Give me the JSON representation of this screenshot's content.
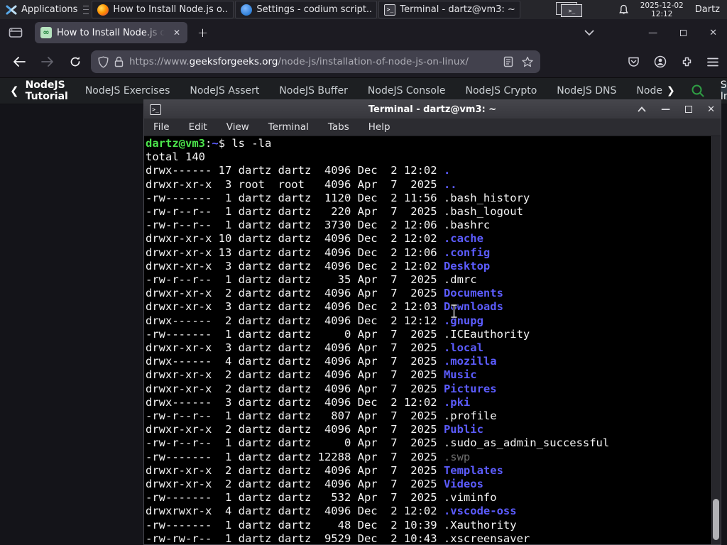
{
  "panel": {
    "applications_label": "Applications",
    "tasks": [
      {
        "icon": "firefox",
        "label": "How to Install Node.js o..."
      },
      {
        "icon": "vscodium",
        "label": "Settings - codium script..."
      },
      {
        "icon": "terminal",
        "label": "Terminal - dartz@vm3: ~"
      }
    ],
    "clock_date": "2025-12-02",
    "clock_time": "12:12",
    "user": "Dartz"
  },
  "browser": {
    "tab_title": "How to Install Node.js on",
    "new_tab_label": "+",
    "url_scheme": "https://www.",
    "url_domain": "geeksforgeeks.org",
    "url_path": "/node-js/installation-of-node-js-on-linux/"
  },
  "page_nav": {
    "back_item": "NodeJS Tutorial",
    "items": [
      "NodeJS Exercises",
      "NodeJS Assert",
      "NodeJS Buffer",
      "NodeJS Console",
      "NodeJS Crypto",
      "NodeJS DNS",
      "Node"
    ],
    "sign_in": "Sign In"
  },
  "terminal": {
    "title": "Terminal - dartz@vm3: ~",
    "menu": [
      "File",
      "Edit",
      "View",
      "Terminal",
      "Tabs",
      "Help"
    ],
    "lines": [
      [
        {
          "t": "dartz@vm3",
          "c": "green"
        },
        {
          "t": ":",
          "c": "fg"
        },
        {
          "t": "~",
          "c": "blue"
        },
        {
          "t": "$ ls -la",
          "c": "fg"
        }
      ],
      [
        {
          "t": "total 140",
          "c": "fg"
        }
      ],
      [
        {
          "t": "drwx------ 17 dartz dartz  4096 Dec  2 12:02 ",
          "c": "fg"
        },
        {
          "t": ".",
          "c": "blue"
        }
      ],
      [
        {
          "t": "drwxr-xr-x  3 root  root   4096 Apr  7  2025 ",
          "c": "fg"
        },
        {
          "t": "..",
          "c": "blue"
        }
      ],
      [
        {
          "t": "-rw-------  1 dartz dartz  1120 Dec  2 11:56 .bash_history",
          "c": "fg"
        }
      ],
      [
        {
          "t": "-rw-r--r--  1 dartz dartz   220 Apr  7  2025 .bash_logout",
          "c": "fg"
        }
      ],
      [
        {
          "t": "-rw-r--r--  1 dartz dartz  3730 Dec  2 12:06 .bashrc",
          "c": "fg"
        }
      ],
      [
        {
          "t": "drwxr-xr-x 10 dartz dartz  4096 Dec  2 12:02 ",
          "c": "fg"
        },
        {
          "t": ".cache",
          "c": "blue"
        }
      ],
      [
        {
          "t": "drwxr-xr-x 13 dartz dartz  4096 Dec  2 12:06 ",
          "c": "fg"
        },
        {
          "t": ".config",
          "c": "blue"
        }
      ],
      [
        {
          "t": "drwxr-xr-x  3 dartz dartz  4096 Dec  2 12:02 ",
          "c": "fg"
        },
        {
          "t": "Desktop",
          "c": "blue"
        }
      ],
      [
        {
          "t": "-rw-r--r--  1 dartz dartz    35 Apr  7  2025 .dmrc",
          "c": "fg"
        }
      ],
      [
        {
          "t": "drwxr-xr-x  2 dartz dartz  4096 Apr  7  2025 ",
          "c": "fg"
        },
        {
          "t": "Documents",
          "c": "blue"
        }
      ],
      [
        {
          "t": "drwxr-xr-x  3 dartz dartz  4096 Dec  2 12:03 ",
          "c": "fg"
        },
        {
          "t": "Downloads",
          "c": "blue"
        }
      ],
      [
        {
          "t": "drwx------  2 dartz dartz  4096 Dec  2 12:12 ",
          "c": "fg"
        },
        {
          "t": ".gnupg",
          "c": "blue"
        }
      ],
      [
        {
          "t": "-rw-------  1 dartz dartz     0 Apr  7  2025 .ICEauthority",
          "c": "fg"
        }
      ],
      [
        {
          "t": "drwxr-xr-x  3 dartz dartz  4096 Apr  7  2025 ",
          "c": "fg"
        },
        {
          "t": ".local",
          "c": "blue"
        }
      ],
      [
        {
          "t": "drwx------  4 dartz dartz  4096 Apr  7  2025 ",
          "c": "fg"
        },
        {
          "t": ".mozilla",
          "c": "blue"
        }
      ],
      [
        {
          "t": "drwxr-xr-x  2 dartz dartz  4096 Apr  7  2025 ",
          "c": "fg"
        },
        {
          "t": "Music",
          "c": "blue"
        }
      ],
      [
        {
          "t": "drwxr-xr-x  2 dartz dartz  4096 Apr  7  2025 ",
          "c": "fg"
        },
        {
          "t": "Pictures",
          "c": "blue"
        }
      ],
      [
        {
          "t": "drwx------  3 dartz dartz  4096 Dec  2 12:02 ",
          "c": "fg"
        },
        {
          "t": ".pki",
          "c": "blue"
        }
      ],
      [
        {
          "t": "-rw-r--r--  1 dartz dartz   807 Apr  7  2025 .profile",
          "c": "fg"
        }
      ],
      [
        {
          "t": "drwxr-xr-x  2 dartz dartz  4096 Apr  7  2025 ",
          "c": "fg"
        },
        {
          "t": "Public",
          "c": "blue"
        }
      ],
      [
        {
          "t": "-rw-r--r--  1 dartz dartz     0 Apr  7  2025 .sudo_as_admin_successful",
          "c": "fg"
        }
      ],
      [
        {
          "t": "-rw-------  1 dartz dartz 12288 Apr  7  2025 ",
          "c": "fg"
        },
        {
          "t": ".swp",
          "c": "gray"
        }
      ],
      [
        {
          "t": "drwxr-xr-x  2 dartz dartz  4096 Apr  7  2025 ",
          "c": "fg"
        },
        {
          "t": "Templates",
          "c": "blue"
        }
      ],
      [
        {
          "t": "drwxr-xr-x  2 dartz dartz  4096 Apr  7  2025 ",
          "c": "fg"
        },
        {
          "t": "Videos",
          "c": "blue"
        }
      ],
      [
        {
          "t": "-rw-------  1 dartz dartz   532 Apr  7  2025 .viminfo",
          "c": "fg"
        }
      ],
      [
        {
          "t": "drwxrwxr-x  4 dartz dartz  4096 Dec  2 12:02 ",
          "c": "fg"
        },
        {
          "t": ".vscode-oss",
          "c": "blue"
        }
      ],
      [
        {
          "t": "-rw-------  1 dartz dartz    48 Dec  2 10:39 .Xauthority",
          "c": "fg"
        }
      ],
      [
        {
          "t": "-rw-rw-r--  1 dartz dartz  9529 Dec  2 10:43 .xscreensaver",
          "c": "fg"
        }
      ]
    ]
  },
  "colors": {
    "panel_bg": "#26262b",
    "browser_chrome": "#1c1b22",
    "urlbar_bg": "#42414d",
    "page_bg": "#141419",
    "terminal_bg": "#000000",
    "prompt_green": "#4ce44c",
    "dir_blue": "#5c5cff",
    "gfg_green": "#2f9e44"
  }
}
